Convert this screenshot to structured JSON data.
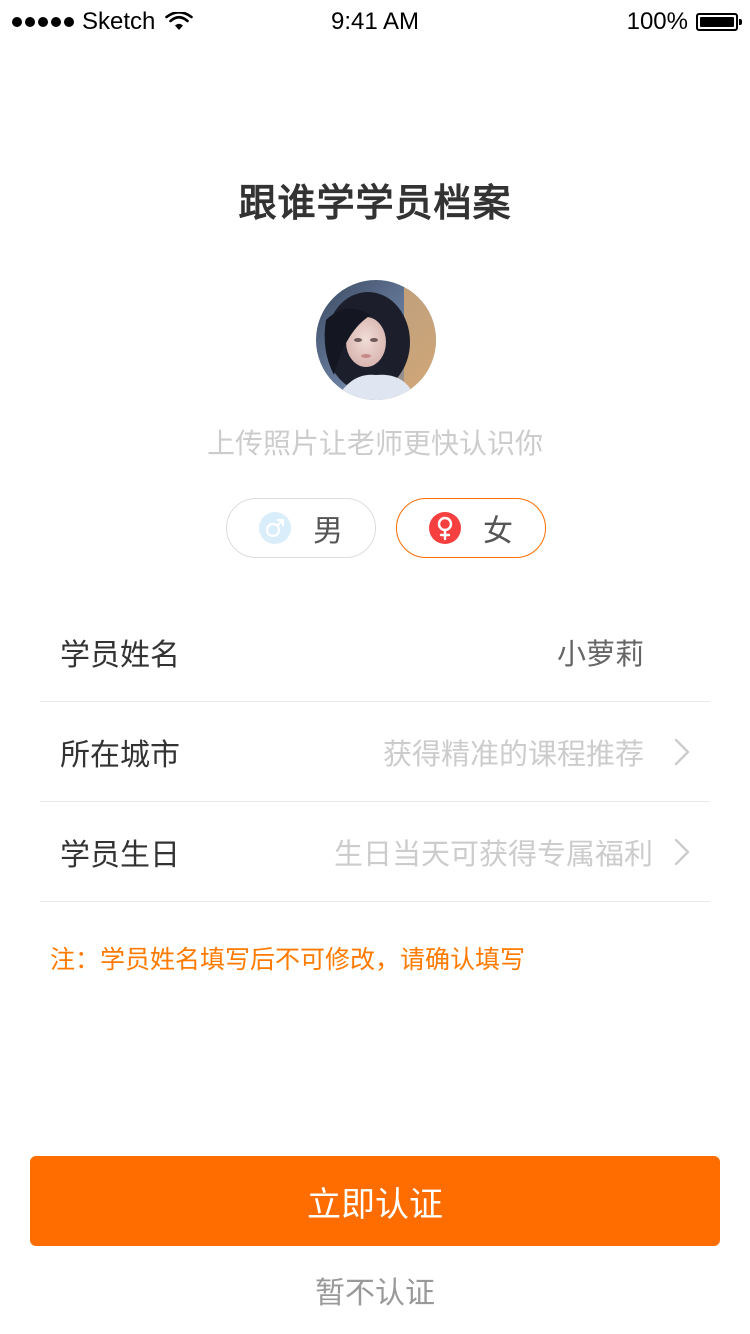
{
  "status_bar": {
    "carrier": "Sketch",
    "time": "9:41 AM",
    "battery": "100%"
  },
  "page": {
    "title": "跟谁学学员档案",
    "upload_hint": "上传照片让老师更快认识你"
  },
  "gender": {
    "male_label": "男",
    "female_label": "女",
    "selected": "female",
    "male_symbol": "♂",
    "female_symbol": "♀"
  },
  "form": {
    "name": {
      "label": "学员姓名",
      "value": "小萝莉"
    },
    "city": {
      "label": "所在城市",
      "placeholder": "获得精准的课程推荐"
    },
    "birthday": {
      "label": "学员生日",
      "placeholder": "生日当天可获得专属福利"
    }
  },
  "note": "注：学员姓名填写后不可修改，请确认填写",
  "actions": {
    "primary": "立即认证",
    "secondary": "暂不认证"
  },
  "colors": {
    "accent": "#ff6d00",
    "female_icon": "#f64040",
    "male_icon_bg": "#d9edfb",
    "male_icon_fg": "#ffffff",
    "placeholder": "#cccccc"
  }
}
